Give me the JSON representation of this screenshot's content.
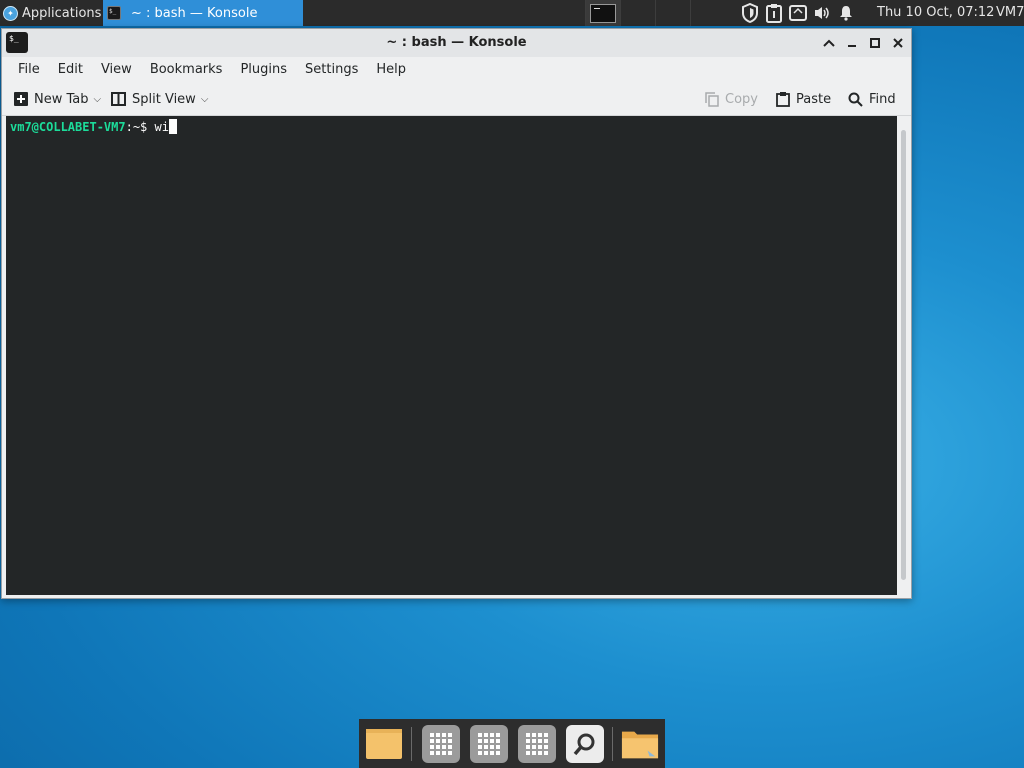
{
  "panel": {
    "applications_label": "Applications",
    "task_title": "~ : bash — Konsole",
    "clock": "Thu 10 Oct, 07:12",
    "user": "VM7"
  },
  "window": {
    "title": "~ : bash — Konsole",
    "menu": [
      "File",
      "Edit",
      "View",
      "Bookmarks",
      "Plugins",
      "Settings",
      "Help"
    ],
    "toolbar": {
      "new_tab": "New Tab",
      "split_view": "Split View",
      "copy": "Copy",
      "paste": "Paste",
      "find": "Find"
    }
  },
  "terminal": {
    "user_host": "vm7@COLLABET-VM7",
    "path": ":~$ ",
    "typed": "wi"
  },
  "colors": {
    "accent": "#2f8fd8",
    "terminal_bg": "#232627",
    "prompt_green": "#1cdc9a"
  },
  "dock": {
    "items": [
      "files-icon",
      "app-grid-icon",
      "app-grid-icon",
      "app-grid-icon",
      "search-icon",
      "folder-icon"
    ]
  }
}
